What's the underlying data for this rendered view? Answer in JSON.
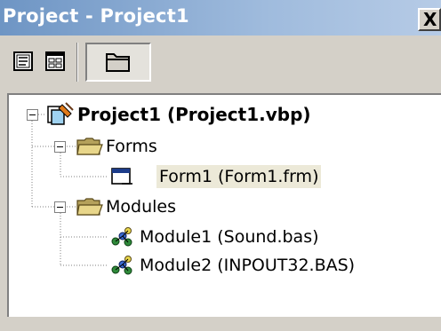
{
  "window": {
    "title": "Project - Project1",
    "close_label": "X"
  },
  "toolbar": {
    "buttons": [
      {
        "name": "View Code",
        "icon": "view-code-icon"
      },
      {
        "name": "View Object",
        "icon": "view-object-icon"
      },
      {
        "name": "Toggle Folders",
        "icon": "folder-icon",
        "pressed": true
      }
    ]
  },
  "tree": {
    "project": {
      "label": "Project1 (Project1.vbp)",
      "expanded": true
    },
    "forms_folder": {
      "label": "Forms",
      "expanded": true
    },
    "form1": {
      "label": "Form1 (Form1.frm)",
      "selected": true
    },
    "modules_folder": {
      "label": "Modules",
      "expanded": true
    },
    "module1": {
      "label": "Module1 (Sound.bas)"
    },
    "module2": {
      "label": "Module2 (INPOUT32.BAS)"
    }
  },
  "colors": {
    "title_gradient_start": "#6e95c4",
    "title_gradient_end": "#b6cbe6",
    "face": "#d4d0c8",
    "selection": "#ece9d8"
  }
}
